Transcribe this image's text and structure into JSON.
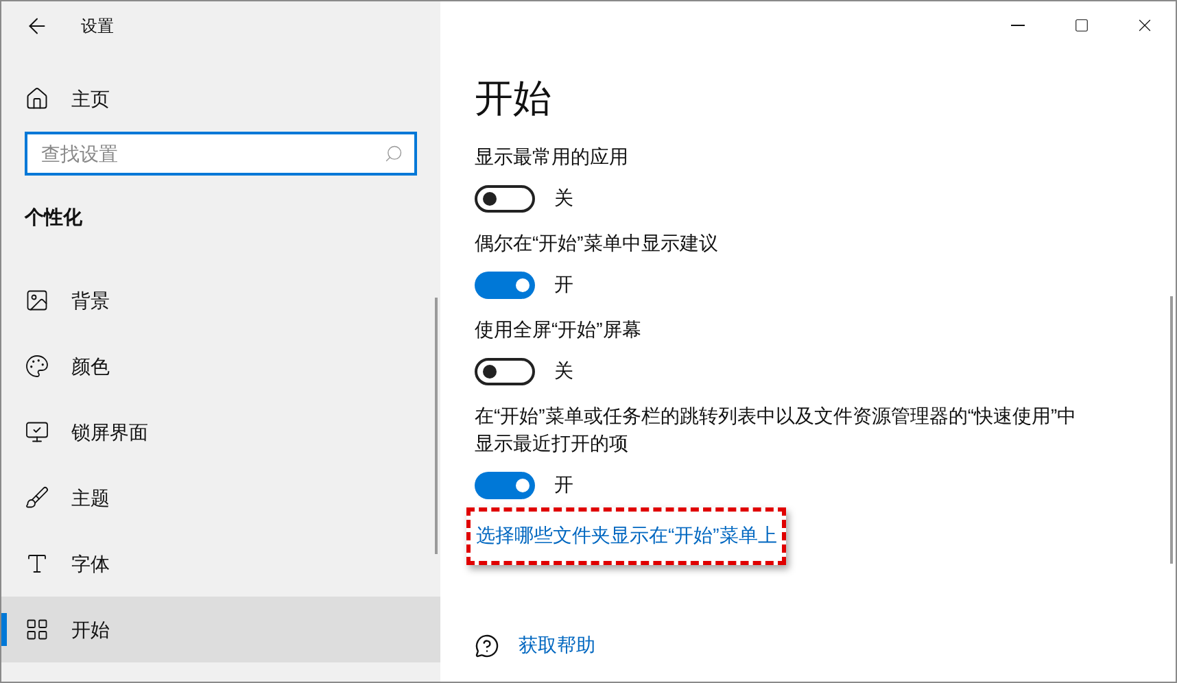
{
  "window": {
    "title": "设置"
  },
  "sidebar": {
    "home": "主页",
    "search": {
      "placeholder": "查找设置"
    },
    "section": "个性化",
    "items": [
      {
        "label": "背景",
        "kind": "background",
        "selected": false
      },
      {
        "label": "颜色",
        "kind": "colors",
        "selected": false
      },
      {
        "label": "锁屏界面",
        "kind": "lockscreen",
        "selected": false
      },
      {
        "label": "主题",
        "kind": "themes",
        "selected": false
      },
      {
        "label": "字体",
        "kind": "fonts",
        "selected": false
      },
      {
        "label": "开始",
        "kind": "start",
        "selected": true
      }
    ]
  },
  "page": {
    "title": "开始",
    "settings": [
      {
        "label": "显示最常用的应用",
        "on": false,
        "state": "关"
      },
      {
        "label": "偶尔在“开始”菜单中显示建议",
        "on": true,
        "state": "开"
      },
      {
        "label": "使用全屏“开始”屏幕",
        "on": false,
        "state": "关"
      },
      {
        "label": "在“开始”菜单或任务栏的跳转列表中以及文件资源管理器的“快速使用”中显示最近打开的项",
        "on": true,
        "state": "开"
      }
    ],
    "link": {
      "label": "选择哪些文件夹显示在“开始”菜单上",
      "highlighted": true
    },
    "help": "获取帮助"
  }
}
